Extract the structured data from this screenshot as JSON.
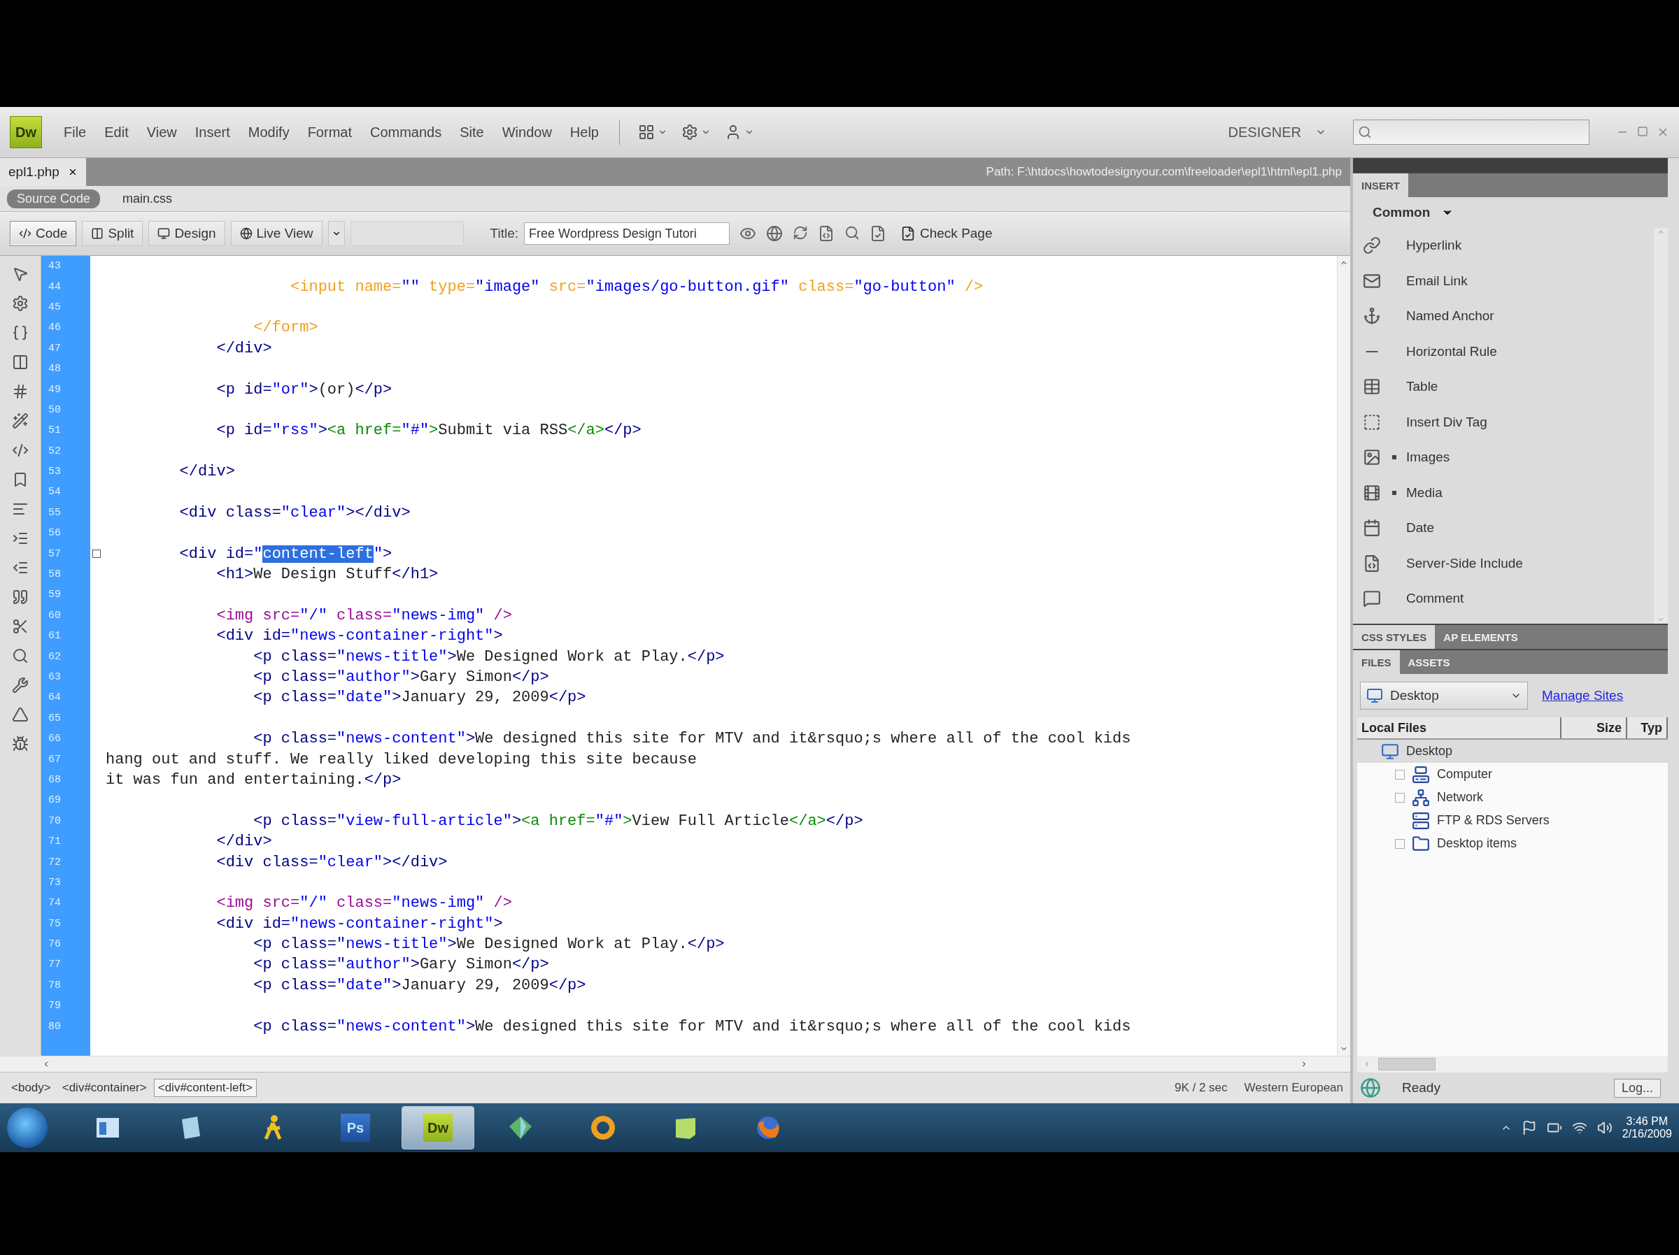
{
  "app": {
    "logo": "Dw",
    "menu": [
      "File",
      "Edit",
      "View",
      "Insert",
      "Modify",
      "Format",
      "Commands",
      "Site",
      "Window",
      "Help"
    ],
    "workspace": "DESIGNER"
  },
  "document_tabs": [
    {
      "label": "epl1.php",
      "selected": true
    }
  ],
  "path": "Path: F:\\htdocs\\howtodesignyour.com\\freeloader\\epl1\\html\\epl1.php",
  "related_files": [
    {
      "label": "Source Code",
      "selected": true
    },
    {
      "label": "main.css",
      "selected": false
    }
  ],
  "view_buttons": [
    {
      "label": "Code",
      "selected": true
    },
    {
      "label": "Split",
      "selected": false
    },
    {
      "label": "Design",
      "selected": false
    },
    {
      "label": "Live View",
      "selected": false
    }
  ],
  "title_field": {
    "label": "Title:",
    "value": "Free Wordpress Design Tutori"
  },
  "check_page": "Check Page",
  "code_lines": [
    {
      "number": "43",
      "marked": false
    },
    {
      "number": "44",
      "marked": false,
      "segments": [
        {
          "kind": "form",
          "text": "                    <input name="
        },
        {
          "kind": "value",
          "text": "\"\""
        },
        {
          "kind": "form",
          "text": " type="
        },
        {
          "kind": "value",
          "text": "\"image\""
        },
        {
          "kind": "form",
          "text": " src="
        },
        {
          "kind": "value",
          "text": "\"images/go-button.gif\""
        },
        {
          "kind": "form",
          "text": " class="
        },
        {
          "kind": "value",
          "text": "\"go-button\""
        },
        {
          "kind": "form",
          "text": " />"
        }
      ]
    },
    {
      "number": "45",
      "marked": false
    },
    {
      "number": "46",
      "marked": false,
      "segments": [
        {
          "kind": "form",
          "text": "                </form>"
        }
      ]
    },
    {
      "number": "47",
      "marked": false,
      "segments": [
        {
          "kind": "tag",
          "text": "            </div>"
        }
      ]
    },
    {
      "number": "48",
      "marked": false
    },
    {
      "number": "49",
      "marked": false,
      "segments": [
        {
          "kind": "tag",
          "text": "            <p id="
        },
        {
          "kind": "value",
          "text": "\"or\""
        },
        {
          "kind": "tag",
          "text": ">"
        },
        {
          "kind": "text",
          "text": "(or)"
        },
        {
          "kind": "tag",
          "text": "</p>"
        }
      ]
    },
    {
      "number": "50",
      "marked": false
    },
    {
      "number": "51",
      "marked": false,
      "segments": [
        {
          "kind": "tag",
          "text": "            <p id="
        },
        {
          "kind": "value",
          "text": "\"rss\""
        },
        {
          "kind": "tag",
          "text": ">"
        },
        {
          "kind": "link",
          "text": "<a href="
        },
        {
          "kind": "value",
          "text": "\"#\""
        },
        {
          "kind": "link",
          "text": ">"
        },
        {
          "kind": "text",
          "text": "Submit via RSS"
        },
        {
          "kind": "link",
          "text": "</a>"
        },
        {
          "kind": "tag",
          "text": "</p>"
        }
      ]
    },
    {
      "number": "52",
      "marked": false
    },
    {
      "number": "53",
      "marked": false,
      "segments": [
        {
          "kind": "tag",
          "text": "        </div>"
        }
      ]
    },
    {
      "number": "54",
      "marked": false
    },
    {
      "number": "55",
      "marked": false,
      "segments": [
        {
          "kind": "tag",
          "text": "        <div class="
        },
        {
          "kind": "value",
          "text": "\"clear\""
        },
        {
          "kind": "tag",
          "text": "></div>"
        }
      ]
    },
    {
      "number": "56",
      "marked": false
    },
    {
      "number": "57",
      "marked": true,
      "segments": [
        {
          "kind": "tag",
          "text": "        <div id="
        },
        {
          "kind": "value",
          "text": "\""
        },
        {
          "kind": "selection",
          "text": "content-left"
        },
        {
          "kind": "value",
          "text": "\""
        },
        {
          "kind": "tag",
          "text": ">"
        }
      ]
    },
    {
      "number": "58",
      "marked": false,
      "segments": [
        {
          "kind": "tag",
          "text": "            <h1>"
        },
        {
          "kind": "text",
          "text": "We Design Stuff"
        },
        {
          "kind": "tag",
          "text": "</h1>"
        }
      ]
    },
    {
      "number": "59",
      "marked": false
    },
    {
      "number": "60",
      "marked": false,
      "segments": [
        {
          "kind": "img",
          "text": "            <img src="
        },
        {
          "kind": "value",
          "text": "\"/\""
        },
        {
          "kind": "img",
          "text": " class="
        },
        {
          "kind": "value",
          "text": "\"news-img\""
        },
        {
          "kind": "img",
          "text": " />"
        }
      ]
    },
    {
      "number": "61",
      "marked": false,
      "segments": [
        {
          "kind": "tag",
          "text": "            <div id="
        },
        {
          "kind": "value",
          "text": "\"news-container-right\""
        },
        {
          "kind": "tag",
          "text": ">"
        }
      ]
    },
    {
      "number": "62",
      "marked": false,
      "segments": [
        {
          "kind": "tag",
          "text": "                <p class="
        },
        {
          "kind": "value",
          "text": "\"news-title\""
        },
        {
          "kind": "tag",
          "text": ">"
        },
        {
          "kind": "text",
          "text": "We Designed Work at Play."
        },
        {
          "kind": "tag",
          "text": "</p>"
        }
      ]
    },
    {
      "number": "63",
      "marked": false,
      "segments": [
        {
          "kind": "tag",
          "text": "                <p class="
        },
        {
          "kind": "value",
          "text": "\"author\""
        },
        {
          "kind": "tag",
          "text": ">"
        },
        {
          "kind": "text",
          "text": "Gary Simon"
        },
        {
          "kind": "tag",
          "text": "</p>"
        }
      ]
    },
    {
      "number": "64",
      "marked": false,
      "segments": [
        {
          "kind": "tag",
          "text": "                <p class="
        },
        {
          "kind": "value",
          "text": "\"date\""
        },
        {
          "kind": "tag",
          "text": ">"
        },
        {
          "kind": "text",
          "text": "January 29, 2009"
        },
        {
          "kind": "tag",
          "text": "</p>"
        }
      ]
    },
    {
      "number": "65",
      "marked": false
    },
    {
      "number": "66",
      "marked": false,
      "segments": [
        {
          "kind": "tag",
          "text": "                <p class="
        },
        {
          "kind": "value",
          "text": "\"news-content\""
        },
        {
          "kind": "tag",
          "text": ">"
        },
        {
          "kind": "text",
          "text": "We designed this site for MTV and it&rsquo;s where all of the cool kids"
        }
      ]
    },
    {
      "number": "67",
      "marked": false,
      "segments": [
        {
          "kind": "text",
          "text": "hang out and stuff. We really liked developing this site because"
        }
      ]
    },
    {
      "number": "68",
      "marked": false,
      "segments": [
        {
          "kind": "text",
          "text": "it was fun and entertaining."
        },
        {
          "kind": "tag",
          "text": "</p>"
        }
      ]
    },
    {
      "number": "69",
      "marked": false
    },
    {
      "number": "70",
      "marked": false,
      "segments": [
        {
          "kind": "tag",
          "text": "                <p class="
        },
        {
          "kind": "value",
          "text": "\"view-full-article\""
        },
        {
          "kind": "tag",
          "text": ">"
        },
        {
          "kind": "link",
          "text": "<a href="
        },
        {
          "kind": "value",
          "text": "\"#\""
        },
        {
          "kind": "link",
          "text": ">"
        },
        {
          "kind": "text",
          "text": "View Full Article"
        },
        {
          "kind": "link",
          "text": "</a>"
        },
        {
          "kind": "tag",
          "text": "</p>"
        }
      ]
    },
    {
      "number": "71",
      "marked": false,
      "segments": [
        {
          "kind": "tag",
          "text": "            </div>"
        }
      ]
    },
    {
      "number": "72",
      "marked": false,
      "segments": [
        {
          "kind": "tag",
          "text": "            <div class="
        },
        {
          "kind": "value",
          "text": "\"clear\""
        },
        {
          "kind": "tag",
          "text": "></div>"
        }
      ]
    },
    {
      "number": "73",
      "marked": false
    },
    {
      "number": "74",
      "marked": false,
      "segments": [
        {
          "kind": "img",
          "text": "            <img src="
        },
        {
          "kind": "value",
          "text": "\"/\""
        },
        {
          "kind": "img",
          "text": " class="
        },
        {
          "kind": "value",
          "text": "\"news-img\""
        },
        {
          "kind": "img",
          "text": " />"
        }
      ]
    },
    {
      "number": "75",
      "marked": false,
      "segments": [
        {
          "kind": "tag",
          "text": "            <div id="
        },
        {
          "kind": "value",
          "text": "\"news-container-right\""
        },
        {
          "kind": "tag",
          "text": ">"
        }
      ]
    },
    {
      "number": "76",
      "marked": false,
      "segments": [
        {
          "kind": "tag",
          "text": "                <p class="
        },
        {
          "kind": "value",
          "text": "\"news-title\""
        },
        {
          "kind": "tag",
          "text": ">"
        },
        {
          "kind": "text",
          "text": "We Designed Work at Play."
        },
        {
          "kind": "tag",
          "text": "</p>"
        }
      ]
    },
    {
      "number": "77",
      "marked": false,
      "segments": [
        {
          "kind": "tag",
          "text": "                <p class="
        },
        {
          "kind": "value",
          "text": "\"author\""
        },
        {
          "kind": "tag",
          "text": ">"
        },
        {
          "kind": "text",
          "text": "Gary Simon"
        },
        {
          "kind": "tag",
          "text": "</p>"
        }
      ]
    },
    {
      "number": "78",
      "marked": false,
      "segments": [
        {
          "kind": "tag",
          "text": "                <p class="
        },
        {
          "kind": "value",
          "text": "\"date\""
        },
        {
          "kind": "tag",
          "text": ">"
        },
        {
          "kind": "text",
          "text": "January 29, 2009"
        },
        {
          "kind": "tag",
          "text": "</p>"
        }
      ]
    },
    {
      "number": "79",
      "marked": false
    },
    {
      "number": "80",
      "marked": false,
      "segments": [
        {
          "kind": "tag",
          "text": "                <p class="
        },
        {
          "kind": "value",
          "text": "\"news-content\""
        },
        {
          "kind": "tag",
          "text": ">"
        },
        {
          "kind": "text",
          "text": "We designed this site for MTV and it&rsquo;s where all of the cool kids"
        }
      ]
    }
  ],
  "tag_selector": [
    {
      "label": "<body>",
      "selected": false
    },
    {
      "label": "<div#container>",
      "selected": false
    },
    {
      "label": "<div#content-left>",
      "selected": true
    }
  ],
  "status_bar": {
    "size": "9K / 2 sec",
    "encoding": "Western European"
  },
  "insert_panel": {
    "tabs": [
      {
        "label": "INSERT",
        "selected": true
      }
    ],
    "category": "Common",
    "items": [
      {
        "label": "Hyperlink",
        "submenu": false
      },
      {
        "label": "Email Link",
        "submenu": false
      },
      {
        "label": "Named Anchor",
        "submenu": false
      },
      {
        "label": "Horizontal Rule",
        "submenu": false
      },
      {
        "label": "Table",
        "submenu": false
      },
      {
        "label": "Insert Div Tag",
        "submenu": false
      },
      {
        "label": "Images",
        "submenu": true
      },
      {
        "label": "Media",
        "submenu": true
      },
      {
        "label": "Date",
        "submenu": false
      },
      {
        "label": "Server-Side Include",
        "submenu": false
      },
      {
        "label": "Comment",
        "submenu": false
      }
    ]
  },
  "css_panel": {
    "tabs": [
      {
        "label": "CSS STYLES",
        "selected": true
      },
      {
        "label": "AP ELEMENTS",
        "selected": false
      }
    ]
  },
  "files_panel": {
    "tabs": [
      {
        "label": "FILES",
        "selected": true
      },
      {
        "label": "ASSETS",
        "selected": false
      }
    ],
    "site": "Desktop",
    "manage_sites": "Manage Sites",
    "columns": [
      "Local Files",
      "Size",
      "Typ"
    ],
    "tree": [
      {
        "label": "Desktop",
        "selected": true,
        "children": [
          {
            "label": "Computer",
            "selected": false,
            "expandable": true
          },
          {
            "label": "Network",
            "selected": false,
            "expandable": true
          },
          {
            "label": "FTP & RDS Servers",
            "selected": false,
            "expandable": false
          },
          {
            "label": "Desktop items",
            "selected": false,
            "expandable": true
          }
        ]
      }
    ],
    "status": "Ready",
    "log_button": "Log..."
  },
  "taskbar": {
    "apps": [
      {
        "kind": "explorer",
        "selected": false
      },
      {
        "kind": "notes",
        "selected": false
      },
      {
        "kind": "figure",
        "selected": false
      },
      {
        "kind": "letters",
        "label": "Ps",
        "selected": false
      },
      {
        "kind": "letters",
        "label": "Dw",
        "selected": true
      },
      {
        "kind": "gem",
        "selected": false
      },
      {
        "kind": "ring",
        "selected": false
      },
      {
        "kind": "sticky",
        "selected": false
      },
      {
        "kind": "firefox",
        "selected": false
      }
    ],
    "time": "3:46 PM",
    "date": "2/16/2009"
  }
}
